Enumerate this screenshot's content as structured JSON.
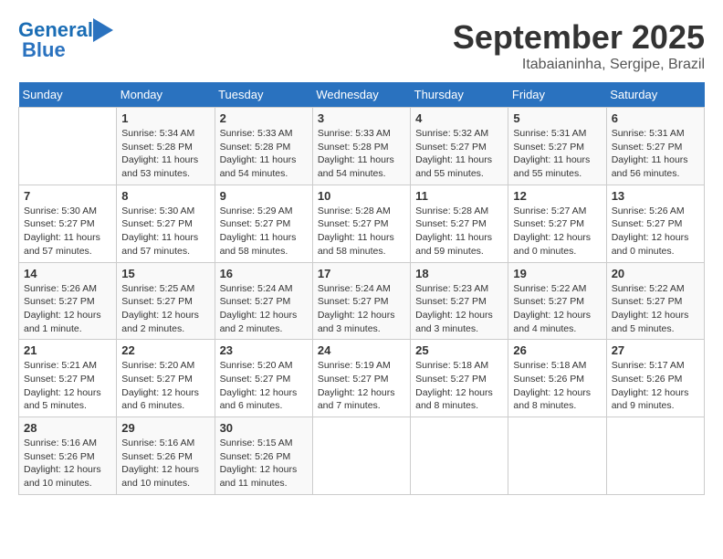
{
  "header": {
    "logo_line1": "General",
    "logo_line2": "Blue",
    "month_title": "September 2025",
    "location": "Itabaianinha, Sergipe, Brazil"
  },
  "weekdays": [
    "Sunday",
    "Monday",
    "Tuesday",
    "Wednesday",
    "Thursday",
    "Friday",
    "Saturday"
  ],
  "weeks": [
    [
      {
        "day": "",
        "info": ""
      },
      {
        "day": "1",
        "info": "Sunrise: 5:34 AM\nSunset: 5:28 PM\nDaylight: 11 hours\nand 53 minutes."
      },
      {
        "day": "2",
        "info": "Sunrise: 5:33 AM\nSunset: 5:28 PM\nDaylight: 11 hours\nand 54 minutes."
      },
      {
        "day": "3",
        "info": "Sunrise: 5:33 AM\nSunset: 5:28 PM\nDaylight: 11 hours\nand 54 minutes."
      },
      {
        "day": "4",
        "info": "Sunrise: 5:32 AM\nSunset: 5:27 PM\nDaylight: 11 hours\nand 55 minutes."
      },
      {
        "day": "5",
        "info": "Sunrise: 5:31 AM\nSunset: 5:27 PM\nDaylight: 11 hours\nand 55 minutes."
      },
      {
        "day": "6",
        "info": "Sunrise: 5:31 AM\nSunset: 5:27 PM\nDaylight: 11 hours\nand 56 minutes."
      }
    ],
    [
      {
        "day": "7",
        "info": "Sunrise: 5:30 AM\nSunset: 5:27 PM\nDaylight: 11 hours\nand 57 minutes."
      },
      {
        "day": "8",
        "info": "Sunrise: 5:30 AM\nSunset: 5:27 PM\nDaylight: 11 hours\nand 57 minutes."
      },
      {
        "day": "9",
        "info": "Sunrise: 5:29 AM\nSunset: 5:27 PM\nDaylight: 11 hours\nand 58 minutes."
      },
      {
        "day": "10",
        "info": "Sunrise: 5:28 AM\nSunset: 5:27 PM\nDaylight: 11 hours\nand 58 minutes."
      },
      {
        "day": "11",
        "info": "Sunrise: 5:28 AM\nSunset: 5:27 PM\nDaylight: 11 hours\nand 59 minutes."
      },
      {
        "day": "12",
        "info": "Sunrise: 5:27 AM\nSunset: 5:27 PM\nDaylight: 12 hours\nand 0 minutes."
      },
      {
        "day": "13",
        "info": "Sunrise: 5:26 AM\nSunset: 5:27 PM\nDaylight: 12 hours\nand 0 minutes."
      }
    ],
    [
      {
        "day": "14",
        "info": "Sunrise: 5:26 AM\nSunset: 5:27 PM\nDaylight: 12 hours\nand 1 minute."
      },
      {
        "day": "15",
        "info": "Sunrise: 5:25 AM\nSunset: 5:27 PM\nDaylight: 12 hours\nand 2 minutes."
      },
      {
        "day": "16",
        "info": "Sunrise: 5:24 AM\nSunset: 5:27 PM\nDaylight: 12 hours\nand 2 minutes."
      },
      {
        "day": "17",
        "info": "Sunrise: 5:24 AM\nSunset: 5:27 PM\nDaylight: 12 hours\nand 3 minutes."
      },
      {
        "day": "18",
        "info": "Sunrise: 5:23 AM\nSunset: 5:27 PM\nDaylight: 12 hours\nand 3 minutes."
      },
      {
        "day": "19",
        "info": "Sunrise: 5:22 AM\nSunset: 5:27 PM\nDaylight: 12 hours\nand 4 minutes."
      },
      {
        "day": "20",
        "info": "Sunrise: 5:22 AM\nSunset: 5:27 PM\nDaylight: 12 hours\nand 5 minutes."
      }
    ],
    [
      {
        "day": "21",
        "info": "Sunrise: 5:21 AM\nSunset: 5:27 PM\nDaylight: 12 hours\nand 5 minutes."
      },
      {
        "day": "22",
        "info": "Sunrise: 5:20 AM\nSunset: 5:27 PM\nDaylight: 12 hours\nand 6 minutes."
      },
      {
        "day": "23",
        "info": "Sunrise: 5:20 AM\nSunset: 5:27 PM\nDaylight: 12 hours\nand 6 minutes."
      },
      {
        "day": "24",
        "info": "Sunrise: 5:19 AM\nSunset: 5:27 PM\nDaylight: 12 hours\nand 7 minutes."
      },
      {
        "day": "25",
        "info": "Sunrise: 5:18 AM\nSunset: 5:27 PM\nDaylight: 12 hours\nand 8 minutes."
      },
      {
        "day": "26",
        "info": "Sunrise: 5:18 AM\nSunset: 5:26 PM\nDaylight: 12 hours\nand 8 minutes."
      },
      {
        "day": "27",
        "info": "Sunrise: 5:17 AM\nSunset: 5:26 PM\nDaylight: 12 hours\nand 9 minutes."
      }
    ],
    [
      {
        "day": "28",
        "info": "Sunrise: 5:16 AM\nSunset: 5:26 PM\nDaylight: 12 hours\nand 10 minutes."
      },
      {
        "day": "29",
        "info": "Sunrise: 5:16 AM\nSunset: 5:26 PM\nDaylight: 12 hours\nand 10 minutes."
      },
      {
        "day": "30",
        "info": "Sunrise: 5:15 AM\nSunset: 5:26 PM\nDaylight: 12 hours\nand 11 minutes."
      },
      {
        "day": "",
        "info": ""
      },
      {
        "day": "",
        "info": ""
      },
      {
        "day": "",
        "info": ""
      },
      {
        "day": "",
        "info": ""
      }
    ]
  ]
}
